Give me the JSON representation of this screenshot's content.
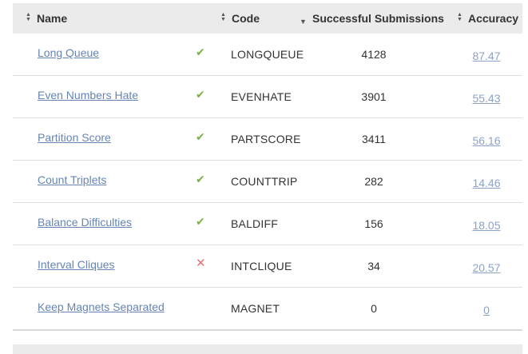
{
  "headers": {
    "name": "Name",
    "code": "Code",
    "submissions": "Successful Submissions",
    "accuracy": "Accuracy"
  },
  "icons": {
    "sort": "sort-updown-icon",
    "sort_desc": "sort-down-icon",
    "solved": "check-icon",
    "failed": "cross-icon"
  },
  "colors": {
    "link": "#6685b3",
    "solved": "#7cb342",
    "failed": "#e57373",
    "header_bg": "#ebebeb"
  },
  "rows": [
    {
      "name": "Long Queue",
      "status": "solved",
      "status_glyph": "✔",
      "code": "LONGQUEUE",
      "submissions": "4128",
      "accuracy": "87.47"
    },
    {
      "name": "Even Numbers Hate",
      "status": "solved",
      "status_glyph": "✔",
      "code": "EVENHATE",
      "submissions": "3901",
      "accuracy": "55.43"
    },
    {
      "name": "Partition Score",
      "status": "solved",
      "status_glyph": "✔",
      "code": "PARTSCORE",
      "submissions": "3411",
      "accuracy": "56.16"
    },
    {
      "name": "Count Triplets",
      "status": "solved",
      "status_glyph": "✔",
      "code": "COUNTTRIP",
      "submissions": "282",
      "accuracy": "14.46"
    },
    {
      "name": "Balance Difficulties",
      "status": "solved",
      "status_glyph": "✔",
      "code": "BALDIFF",
      "submissions": "156",
      "accuracy": "18.05"
    },
    {
      "name": "Interval Cliques",
      "status": "failed",
      "status_glyph": "✕",
      "code": "INTCLIQUE",
      "submissions": "34",
      "accuracy": "20.57"
    },
    {
      "name": "Keep Magnets Separated",
      "status": "none",
      "status_glyph": "",
      "code": "MAGNET",
      "submissions": "0",
      "accuracy": "0"
    }
  ]
}
